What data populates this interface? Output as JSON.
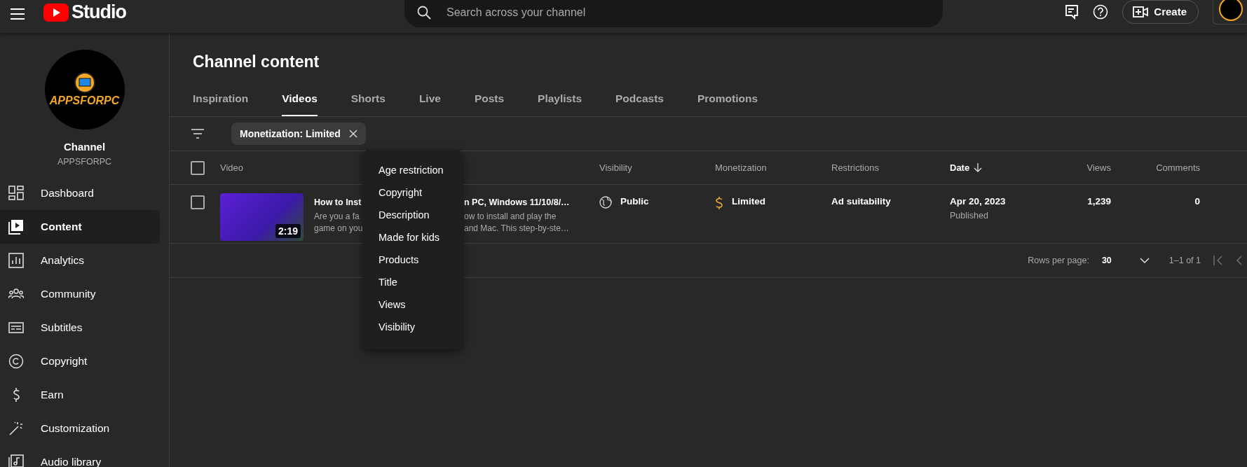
{
  "header": {
    "logo_text": "Studio",
    "search": {
      "placeholder": "Search across your channel"
    },
    "create_label": "Create"
  },
  "sidebar": {
    "logo_text": "APPSFORPC",
    "channel_label": "Channel",
    "channel_name": "APPSFORPC",
    "items": [
      {
        "label": "Dashboard",
        "kind": "dashboard",
        "selected": false
      },
      {
        "label": "Content",
        "kind": "content",
        "selected": true
      },
      {
        "label": "Analytics",
        "kind": "analytics",
        "selected": false
      },
      {
        "label": "Community",
        "kind": "community",
        "selected": false
      },
      {
        "label": "Subtitles",
        "kind": "subtitles",
        "selected": false
      },
      {
        "label": "Copyright",
        "kind": "copyright",
        "selected": false
      },
      {
        "label": "Earn",
        "kind": "earn",
        "selected": false
      },
      {
        "label": "Customization",
        "kind": "customization",
        "selected": false
      },
      {
        "label": "Audio library",
        "kind": "audio",
        "selected": false
      }
    ]
  },
  "page": {
    "title": "Channel content"
  },
  "tabs": [
    {
      "label": "Inspiration",
      "selected": false
    },
    {
      "label": "Videos",
      "selected": true
    },
    {
      "label": "Shorts",
      "selected": false
    },
    {
      "label": "Live",
      "selected": false
    },
    {
      "label": "Posts",
      "selected": false
    },
    {
      "label": "Playlists",
      "selected": false
    },
    {
      "label": "Podcasts",
      "selected": false
    },
    {
      "label": "Promotions",
      "selected": false
    }
  ],
  "filter": {
    "chip": "Monetization: Limited"
  },
  "table": {
    "select_all": {
      "checked": false
    },
    "columns": [
      {
        "label": "Video",
        "sorted": false
      },
      {
        "label": "Visibility",
        "sorted": false
      },
      {
        "label": "Monetization",
        "sorted": false
      },
      {
        "label": "Restrictions",
        "sorted": false
      },
      {
        "label": "Date",
        "sorted": true
      },
      {
        "label": "Views",
        "sorted": false
      },
      {
        "label": "Comments",
        "sorted": false
      }
    ],
    "rows": [
      {
        "checked": false,
        "duration": "2:19",
        "title_start": "How to Inst",
        "title_end": "n PC, Windows 11/10/8/…",
        "description": [
          {
            "start": "Are you a fa",
            "end": "ow to install and play the"
          },
          {
            "start": "game on you",
            "end": "and Mac. This step-by-ste…"
          }
        ],
        "visibility": "Public",
        "monetization": "Limited",
        "restrictions": "Ad suitability",
        "date": "Apr 20, 2023",
        "date_status": "Published",
        "views": "1,239",
        "comments": "0"
      }
    ]
  },
  "menu": {
    "items": [
      "Age restriction",
      "Copyright",
      "Description",
      "Made for kids",
      "Products",
      "Title",
      "Views",
      "Visibility"
    ]
  },
  "pagination": {
    "rows_label": "Rows per page:",
    "rows_value": "30",
    "range": "1–1 of 1"
  }
}
